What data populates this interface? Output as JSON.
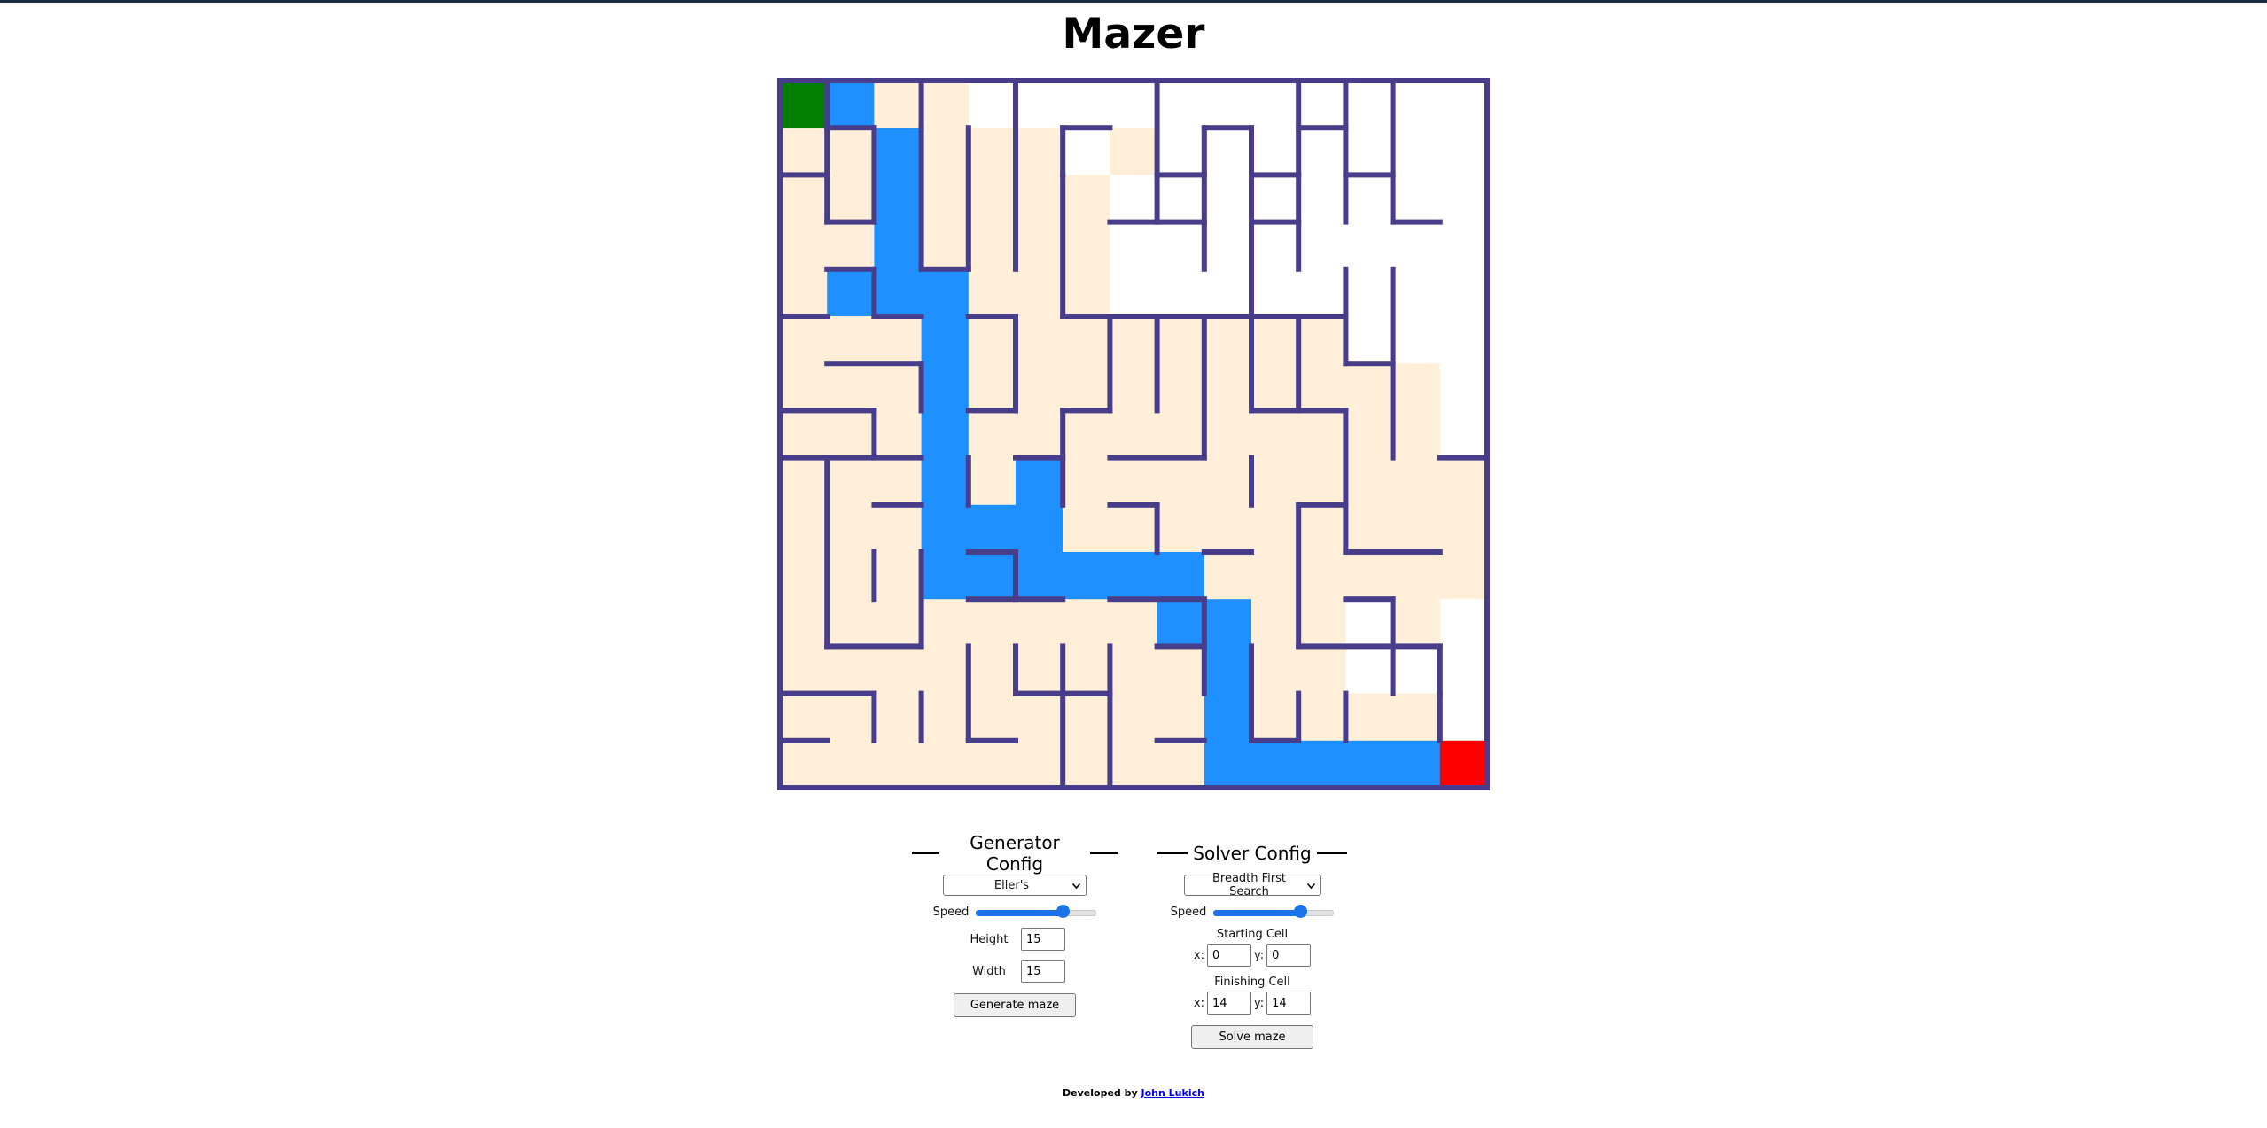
{
  "app": {
    "title": "Mazer"
  },
  "maze": {
    "rows": 15,
    "cols": 15,
    "colors": {
      "wall": "#483d8b",
      "visited": "#ffefd8",
      "unvisited": "#ffffff",
      "path": "#1e90ff",
      "start": "#008000",
      "finish": "#ff0000"
    },
    "start_cell": [
      0,
      0
    ],
    "finish_cell": [
      14,
      14
    ],
    "cell_states": [
      "SPVVUUUUUUUUUUU",
      "VVPVVVUVUUUUUUU",
      "VVPVVVVUUUUUUUU",
      "VVPVVVVUUUUUUUU",
      "VPPPVVVUUUUUUUU",
      "VVVPVVVVVVVVUUU",
      "VVVPVVVVVVVVVVU",
      "VVVPVVVVVVVVVVU",
      "VVVPVPVVVVVVVVV",
      "VVVPPPVVVVVVVVV",
      "VVVPPPPPPVVVVVV",
      "VVVVVVVVPPVVUVU",
      "VVVVVVVVVPVVUUU",
      "VVVVVVVVVPVVVVU",
      "VVVVVVVVVPPPPPF"
    ]
  },
  "generator": {
    "legend": "Generator Config",
    "algorithm": "Eller's",
    "speed_label": "Speed",
    "speed_fraction": 0.72,
    "height_label": "Height",
    "height_value": "15",
    "width_label": "Width",
    "width_value": "15",
    "button": "Generate maze"
  },
  "solver": {
    "legend": "Solver Config",
    "algorithm": "Breadth First Search",
    "speed_label": "Speed",
    "speed_fraction": 0.72,
    "start_label": "Starting Cell",
    "finish_label": "Finishing Cell",
    "x_label": "x:",
    "y_label": "y:",
    "start_x": "0",
    "start_y": "0",
    "finish_x": "14",
    "finish_y": "14",
    "button": "Solve maze"
  },
  "footer": {
    "prefix": "Developed by",
    "author": "John Lukich"
  }
}
